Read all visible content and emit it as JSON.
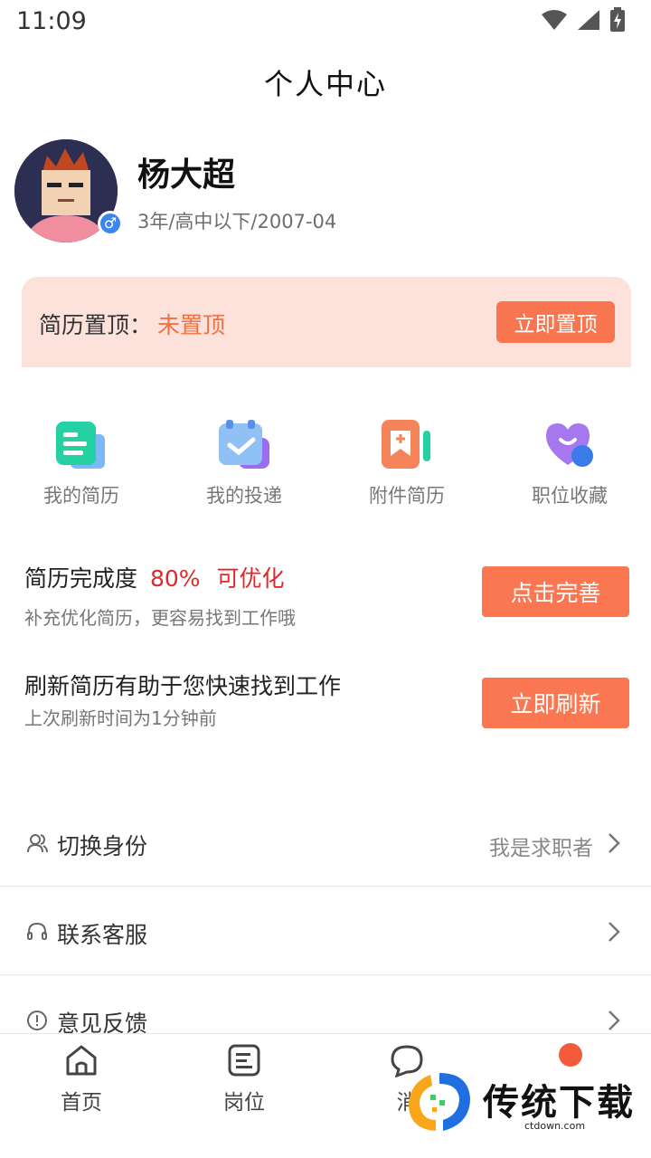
{
  "status_bar": {
    "time": "11:09"
  },
  "header": {
    "title": "个人中心"
  },
  "profile": {
    "name": "杨大超",
    "meta": "3年/高中以下/2007-04",
    "gender_symbol": "♂"
  },
  "resume_top": {
    "label": "简历置顶：",
    "status": "未置顶",
    "button": "立即置顶"
  },
  "quick_menu": [
    {
      "label": "我的简历",
      "icon": "resume-icon"
    },
    {
      "label": "我的投递",
      "icon": "delivery-icon"
    },
    {
      "label": "附件简历",
      "icon": "attachment-resume-icon"
    },
    {
      "label": "职位收藏",
      "icon": "favorite-heart-icon"
    }
  ],
  "completion": {
    "title": "简历完成度",
    "percent": "80%",
    "hint": "可优化",
    "subtitle": "补充优化简历，更容易找到工作哦",
    "button": "点击完善"
  },
  "refresh": {
    "title": "刷新简历有助于您快速找到工作",
    "subtitle": "上次刷新时间为1分钟前",
    "button": "立即刷新"
  },
  "settings": [
    {
      "label": "切换身份",
      "value": "我是求职者"
    },
    {
      "label": "联系客服",
      "value": ""
    },
    {
      "label": "意见反馈",
      "value": ""
    }
  ],
  "tabbar": [
    {
      "label": "首页"
    },
    {
      "label": "岗位"
    },
    {
      "label": "消"
    }
  ],
  "watermark": {
    "text": "传统下载",
    "url": "ctdown.com"
  },
  "colors": {
    "accent": "#FB7752",
    "top_card_bg": "#FDE1DB",
    "highlight_red": "#E02828",
    "gender_badge": "#3A87EE"
  }
}
